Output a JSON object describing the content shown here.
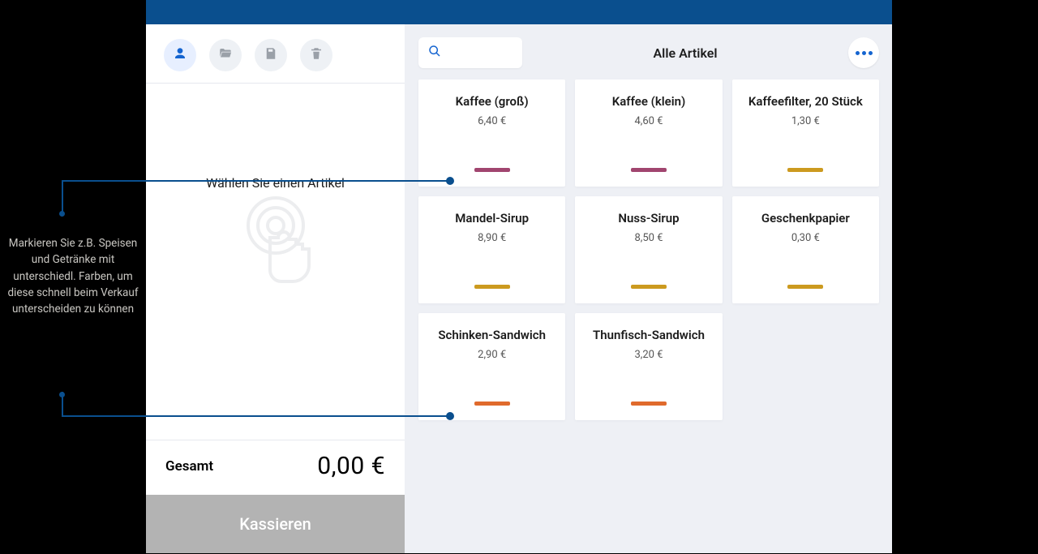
{
  "callout": {
    "text": "Markieren Sie z.B. Speisen und Getränke mit unterschiedl. Farben, um diese schnell beim Verkauf unterscheiden zu können"
  },
  "cart": {
    "empty_prompt": "Wählen Sie einen Artikel",
    "total_label": "Gesamt",
    "total_amount": "0,00 €",
    "checkout_label": "Kassieren"
  },
  "catalog": {
    "title": "Alle Artikel",
    "items": [
      {
        "name": "Kaffee (groß)",
        "price": "6,40 €",
        "color": "#a1456f"
      },
      {
        "name": "Kaffee (klein)",
        "price": "4,60 €",
        "color": "#a1456f"
      },
      {
        "name": "Kaffeefilter, 20 Stück",
        "price": "1,30 €",
        "color": "#cc9a1f"
      },
      {
        "name": "Mandel-Sirup",
        "price": "8,90 €",
        "color": "#cc9a1f"
      },
      {
        "name": "Nuss-Sirup",
        "price": "8,50 €",
        "color": "#cc9a1f"
      },
      {
        "name": "Geschenkpapier",
        "price": "0,30 €",
        "color": "#cc9a1f"
      },
      {
        "name": "Schinken-Sandwich",
        "price": "2,90 €",
        "color": "#e06a2c"
      },
      {
        "name": "Thunfisch-Sandwich",
        "price": "3,20 €",
        "color": "#e06a2c"
      }
    ]
  }
}
